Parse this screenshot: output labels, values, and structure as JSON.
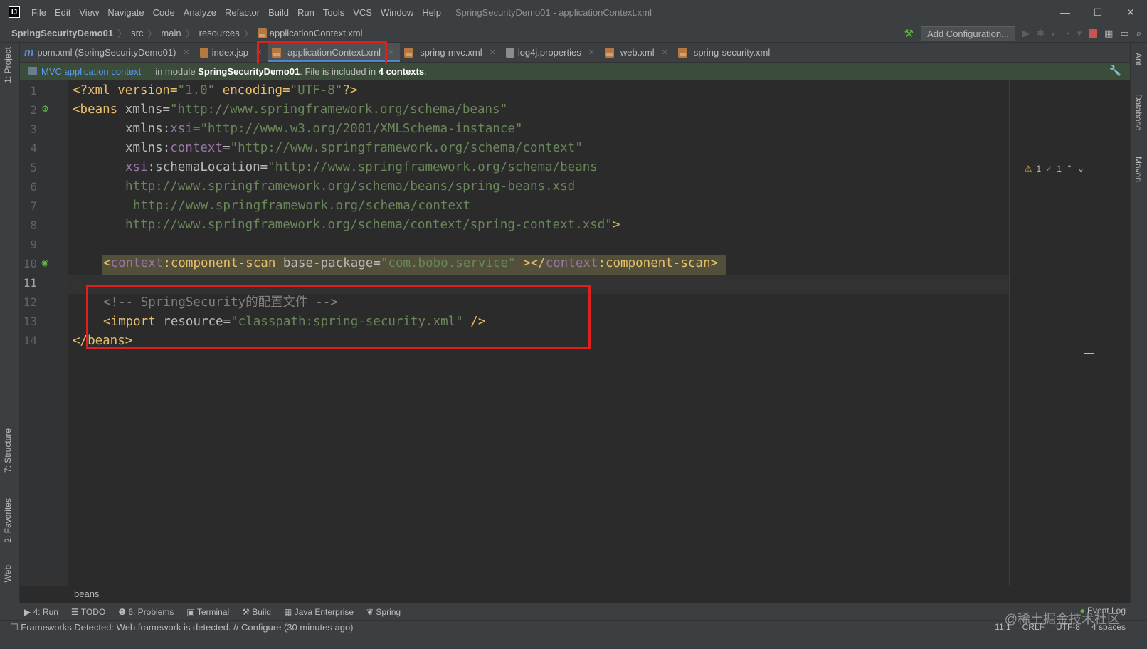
{
  "window": {
    "title": "SpringSecurityDemo01 - applicationContext.xml",
    "controls": [
      "—",
      "☐",
      "✕"
    ]
  },
  "menu": [
    "File",
    "Edit",
    "View",
    "Navigate",
    "Code",
    "Analyze",
    "Refactor",
    "Build",
    "Run",
    "Tools",
    "VCS",
    "Window",
    "Help"
  ],
  "navbar": {
    "crumbs": [
      "SpringSecurityDemo01",
      "src",
      "main",
      "resources",
      "applicationContext.xml"
    ],
    "add_configuration": "Add Configuration..."
  },
  "tabs": [
    {
      "label": "pom.xml (SpringSecurityDemo01)",
      "icon": "maven-m-icon",
      "active": false
    },
    {
      "label": "index.jsp",
      "icon": "jsp-file-icon",
      "active": false
    },
    {
      "label": "applicationContext.xml",
      "icon": "xml-file-icon",
      "active": true
    },
    {
      "label": "spring-mvc.xml",
      "icon": "xml-file-icon",
      "active": false
    },
    {
      "label": "log4j.properties",
      "icon": "properties-file-icon",
      "active": false
    },
    {
      "label": "web.xml",
      "icon": "xml-file-icon",
      "active": false
    },
    {
      "label": "spring-security.xml",
      "icon": "xml-file-icon",
      "active": false
    }
  ],
  "infobar": {
    "context_link": "MVC application context",
    "msg_prefix": "in module ",
    "module": "SpringSecurityDemo01",
    "msg_mid": ". File is included in ",
    "count": "4 contexts",
    "msg_end": "."
  },
  "left_tools": [
    "1: Project",
    "7: Structure",
    "2: Favorites",
    "Web"
  ],
  "right_tools": [
    "Ant",
    "Database",
    "Maven"
  ],
  "analysis": {
    "warnings": "1",
    "ok": "1"
  },
  "code": {
    "line_numbers": [
      "1",
      "2",
      "3",
      "4",
      "5",
      "6",
      "7",
      "8",
      "9",
      "10",
      "11",
      "12",
      "13",
      "14"
    ],
    "l1": {
      "t1": "<?xml version=",
      "v1": "\"1.0\"",
      "t2": " encoding=",
      "v2": "\"UTF-8\"",
      "t3": "?>"
    },
    "l2": {
      "t1": "<beans ",
      "a1": "xmlns",
      "p1": "=",
      "v1": "\"http://www.springframework.org/schema/beans\""
    },
    "l3": {
      "a1": "xmlns",
      "p1": ":",
      "n1": "xsi",
      "p2": "=",
      "v1": "\"http://www.w3.org/2001/XMLSchema-instance\""
    },
    "l4": {
      "a1": "xmlns",
      "p1": ":",
      "n1": "context",
      "p2": "=",
      "v1": "\"http://www.springframework.org/schema/context\""
    },
    "l5": {
      "n1": "xsi",
      "p1": ":",
      "a1": "schemaLocation",
      "p2": "=",
      "v1": "\"http://www.springframework.org/schema/beans"
    },
    "l6": {
      "v1": "http://www.springframework.org/schema/beans/spring-beans.xsd"
    },
    "l7": {
      "v1": "http://www.springframework.org/schema/context"
    },
    "l8": {
      "v1": "http://www.springframework.org/schema/context/spring-context.xsd\"",
      "t1": ">"
    },
    "l10": {
      "t1": "<",
      "n1": "context",
      "t2": ":component-scan ",
      "a1": "base-package",
      "p1": "=",
      "v1": "\"com.bobo.service\"",
      "t3": " ></",
      "n2": "context",
      "t4": ":component-scan>"
    },
    "l12": {
      "c1": "<!-- SpringSecurity的配置文件 -->"
    },
    "l13": {
      "t1": "<import ",
      "a1": "resource",
      "p1": "=",
      "v1": "\"classpath:spring-security.xml\"",
      "t2": " />"
    },
    "l14": {
      "t1": "</beans>"
    }
  },
  "breadcrumb": "beans",
  "toolwindows": [
    "4: Run",
    "TODO",
    "6: Problems",
    "Terminal",
    "Build",
    "Java Enterprise",
    "Spring"
  ],
  "event_log": "Event Log",
  "status": {
    "message": "Frameworks Detected: Web framework is detected. // Configure (30 minutes ago)",
    "position": "11:1",
    "line_sep": "CRLF",
    "encoding": "UTF-8",
    "indent": "4 spaces"
  },
  "watermark": "@稀土掘金技术社区",
  "colors": {
    "highlight_box": "#e0201f",
    "accent": "#4a88c7",
    "tag": "#e8bf6a",
    "string": "#6a8759",
    "namespace": "#9876aa"
  }
}
